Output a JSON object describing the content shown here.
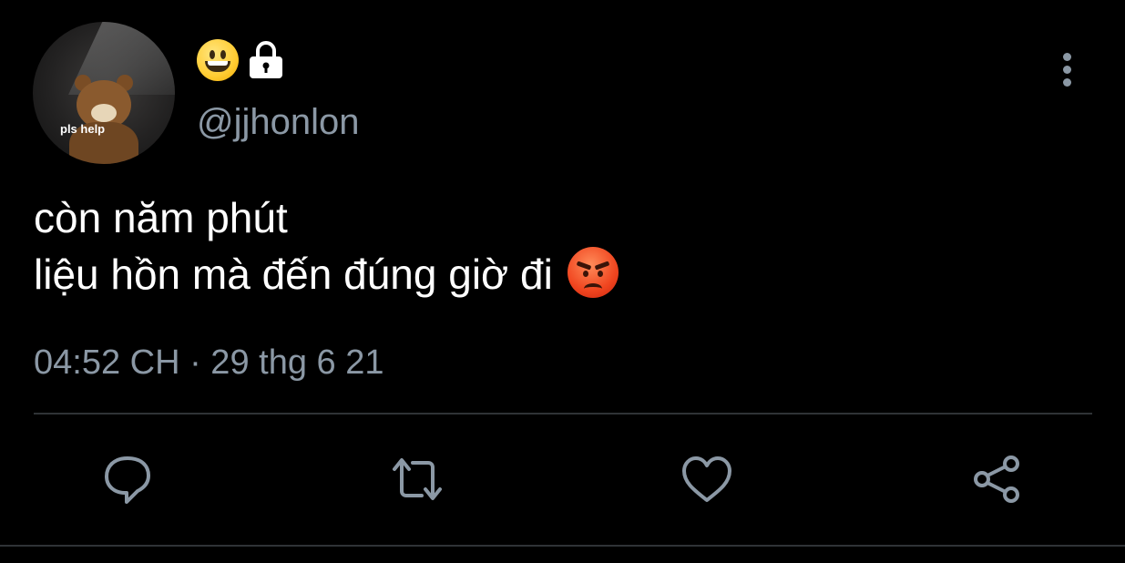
{
  "user": {
    "handle": "@jjhonlon",
    "avatar_caption": "pls help",
    "name_icons": [
      "grinning-face-emoji",
      "lock-icon"
    ]
  },
  "tweet": {
    "lines": [
      "còn năm phút",
      "liệu hồn mà đến đúng giờ đi"
    ],
    "trailing_emoji": "angry-face-emoji",
    "timestamp": "04:52 CH · 29 thg 6 21"
  },
  "actions": [
    {
      "name": "reply",
      "icon": "comment-bubble-icon"
    },
    {
      "name": "retweet",
      "icon": "retweet-icon"
    },
    {
      "name": "like",
      "icon": "heart-icon"
    },
    {
      "name": "share",
      "icon": "share-icon"
    }
  ],
  "colors": {
    "background": "#000000",
    "text": "#ffffff",
    "muted": "#8b98a5",
    "divider": "#2f3336"
  }
}
